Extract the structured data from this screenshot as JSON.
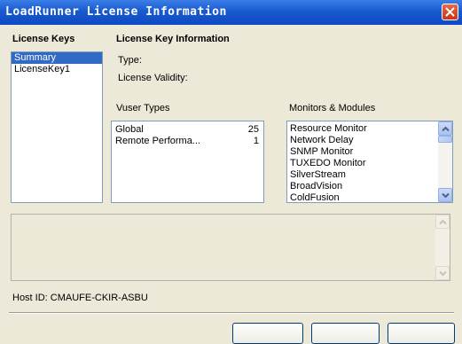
{
  "window": {
    "title": "LoadRunner License Information"
  },
  "license_keys": {
    "heading": "License Keys",
    "items": [
      {
        "label": "Summary",
        "selected": true
      },
      {
        "label": "LicenseKey1",
        "selected": false
      }
    ]
  },
  "key_info": {
    "heading": "License Key Information",
    "type_label": "Type:",
    "validity_label": "License Validity:"
  },
  "vuser_types": {
    "heading": "Vuser Types",
    "rows": [
      {
        "name": "Global",
        "count": "25"
      },
      {
        "name": "Remote Performa...",
        "count": "1"
      }
    ]
  },
  "monitors": {
    "heading": "Monitors & Modules",
    "items": [
      "Resource Monitor",
      "Network Delay",
      "SNMP Monitor",
      "TUXEDO Monitor",
      "SilverStream",
      "BroadVision",
      "ColdFusion"
    ]
  },
  "host": {
    "label": "Host ID:",
    "value": "CMAUFE-CKIR-ASBU"
  },
  "colors": {
    "titlebar": "#0d48c2",
    "selection": "#316ac5",
    "dialog_bg": "#ece9d8"
  }
}
